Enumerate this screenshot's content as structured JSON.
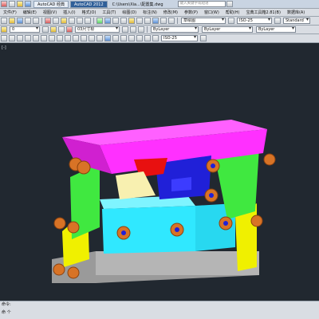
{
  "titlebar": {
    "tabs": [
      "AutoCAD 经典",
      "AutoCAD 2012",
      "C:\\Users\\Xia...\\配置集.dwg"
    ],
    "search_placeholder": "键入关键字或短语"
  },
  "menubar": {
    "items": [
      "文件(F)",
      "编辑(E)",
      "视图(V)",
      "插入(I)",
      "格式(O)",
      "工具(T)",
      "绘图(D)",
      "标注(N)",
      "修改(M)",
      "参数(P)",
      "窗口(W)",
      "帮助(H)",
      "宝典工具箱2.81(B)",
      "数据库(A)"
    ]
  },
  "toolbar1": {
    "layer_combo": "草绘图",
    "dimstyle_combo": "ISO-25",
    "textstyle_combo": "Standard"
  },
  "toolbar2": {
    "layer_combo": "0",
    "dim_combo": "03尺寸标",
    "color_combo": "ByLayer",
    "linetype_combo": "ByLayer",
    "lineweight_combo": "ByLayer"
  },
  "toolbar3": {
    "dim_scale": "ISO-25",
    "bylayer": "ByLayer"
  },
  "viewport": {
    "label": "[-]"
  },
  "statusbar": {
    "line1": "命令: ",
    "line2": "命 个"
  },
  "colors": {
    "magenta": "#ff40ff",
    "cyan": "#30e8ff",
    "yellow": "#f5f500",
    "green": "#40e840",
    "blue": "#2020d8",
    "red": "#e81010",
    "gray": "#a8a8a8",
    "orange": "#e07a28"
  }
}
